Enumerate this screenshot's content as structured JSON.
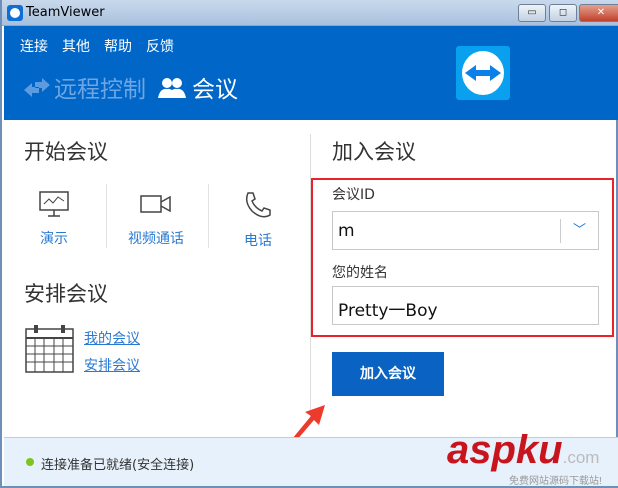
{
  "window": {
    "title": "TeamViewer",
    "minimize": "▭",
    "maximize": "◻",
    "close": "✕"
  },
  "menu": [
    "连接",
    "其他",
    "帮助",
    "反馈"
  ],
  "tabs": {
    "remote": "远程控制",
    "meeting": "会议"
  },
  "start": {
    "heading": "开始会议",
    "options": [
      "演示",
      "视频通话",
      "电话"
    ]
  },
  "schedule": {
    "heading": "安排会议",
    "links": [
      "我的会议",
      "安排会议"
    ]
  },
  "join": {
    "heading": "加入会议",
    "id_label": "会议ID",
    "id_value": "m",
    "name_label": "您的姓名",
    "name_value": "Pretty一Boy",
    "button": "加入会议"
  },
  "status": {
    "text": "连接准备已就绪(安全连接)",
    "color": "#7cc41f"
  },
  "watermark": {
    "brand": "aspku",
    "domain": ".com",
    "tagline": "免费网站源码下载站!"
  },
  "colors": {
    "header": "#0066c8",
    "accent": "#0a62c2",
    "highlight": "#e8232a"
  }
}
